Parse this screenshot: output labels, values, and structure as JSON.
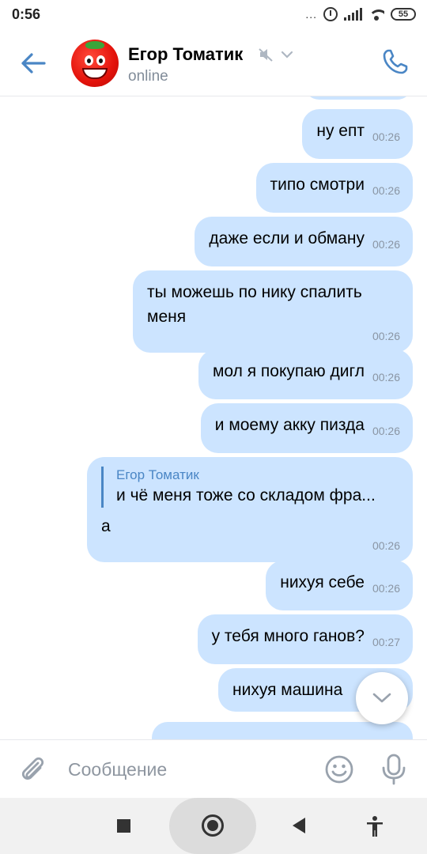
{
  "status_bar": {
    "time": "0:56",
    "dots": "...",
    "battery": "55"
  },
  "header": {
    "contact_name": "Егор Томатик",
    "contact_status": "online",
    "accent_color": "#4a86c5"
  },
  "messages": [
    {
      "text": "ну епт",
      "time": "00:26"
    },
    {
      "text": "типо смотри",
      "time": "00:26"
    },
    {
      "text": "даже если и обману",
      "time": "00:26"
    },
    {
      "text": "ты можешь по нику спалить меня",
      "time": "00:26"
    },
    {
      "text": "мол я покупаю дигл",
      "time": "00:26"
    },
    {
      "text": "и моему акку пизда",
      "time": "00:26"
    },
    {
      "reply_to": {
        "name": "Егор Томатик",
        "text": "и чё меня тоже со складом фра..."
      },
      "text": "а",
      "time": "00:26"
    },
    {
      "text": "нихуя себе",
      "time": "00:26"
    },
    {
      "text": "у тебя много ганов?",
      "time": "00:27"
    },
    {
      "text": "нихуя машина",
      "time": ""
    }
  ],
  "composer": {
    "placeholder": "Сообщение"
  },
  "colors": {
    "bubble": "#cce4ff",
    "timestamp": "#8a95a3",
    "icon": "#4a86c5"
  },
  "icons": [
    "back-arrow-icon",
    "muted-icon",
    "chevron-down-icon",
    "phone-icon",
    "attach-icon",
    "emoji-icon",
    "microphone-icon",
    "chevron-down-icon"
  ]
}
